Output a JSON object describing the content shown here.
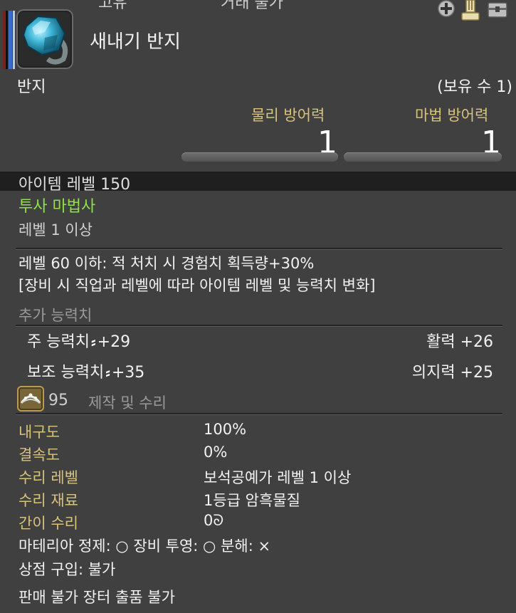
{
  "header": {
    "tag_unique": "고유",
    "tag_untradable": "거래 불가"
  },
  "item": {
    "name": "새내기 반지",
    "type": "반지",
    "owned": "(보유 수 1)",
    "rarity_color": "#3a6bd1"
  },
  "stats": [
    {
      "label": "물리 방어력",
      "value": "1"
    },
    {
      "label": "마법 방어력",
      "value": "1"
    }
  ],
  "item_level": "아이템 레벨 150",
  "job": "투사 마법사",
  "level_req": "레벨 1 이상",
  "bonus_lines": [
    "레벨 60 이하: 적 처치 시 경험치 획득량+30%",
    "[장비 시 직업과 레벨에 따라 아이템 레벨 및 능력치 변화]"
  ],
  "attributes_title": "추가 능력치",
  "attributes": [
    {
      "left_label": "주 능력치",
      "left_value": "+29",
      "right": "활력 +26"
    },
    {
      "left_label": "보조 능력치",
      "left_value": "+35",
      "right": "의지력 +25"
    }
  ],
  "sync_symbol": "⸗",
  "crafting": {
    "level": "95",
    "title": "제작 및 수리",
    "rows": [
      {
        "label": "내구도",
        "value": "100%"
      },
      {
        "label": "결속도",
        "value": "0%"
      },
      {
        "label": "수리 레벨",
        "value": "보석공예가 레벨 1 이상"
      },
      {
        "label": "수리 재료",
        "value": "1등급 암흑물질"
      },
      {
        "label": "간이 수리",
        "value": "0ᘐ"
      }
    ]
  },
  "misc": {
    "materia_line": "마테리아 정제: ○    장비 투영: ○    분해: ×",
    "shop_line": "상점 구입: 불가",
    "sell_line": "판매 불가  장터 출품 불가"
  },
  "icons": [
    "plus-icon",
    "glamour-icon",
    "storage-chest-icon",
    "blue-gem-ring-icon",
    "jeweled-circlet-icon"
  ]
}
